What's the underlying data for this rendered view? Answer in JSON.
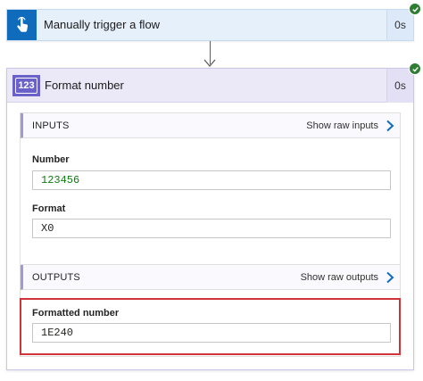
{
  "trigger": {
    "title": "Manually trigger a flow",
    "duration": "0s",
    "icon": "touch-hand-icon",
    "status": "succeeded"
  },
  "action": {
    "title": "Format number",
    "icon_glyph": "123",
    "duration": "0s",
    "status": "succeeded",
    "inputs": {
      "label": "INPUTS",
      "raw_link": "Show raw inputs",
      "fields": [
        {
          "label": "Number",
          "value": "123456"
        },
        {
          "label": "Format",
          "value": "X0"
        }
      ]
    },
    "outputs": {
      "label": "OUTPUTS",
      "raw_link": "Show raw outputs",
      "fields": [
        {
          "label": "Formatted number",
          "value": "1E240"
        }
      ]
    }
  },
  "colors": {
    "trigger_accent": "#0f6cbd",
    "action_accent": "#6b62c9",
    "success": "#2e7d32",
    "highlight": "#d13438",
    "link_chevron": "#0f6cbd"
  }
}
